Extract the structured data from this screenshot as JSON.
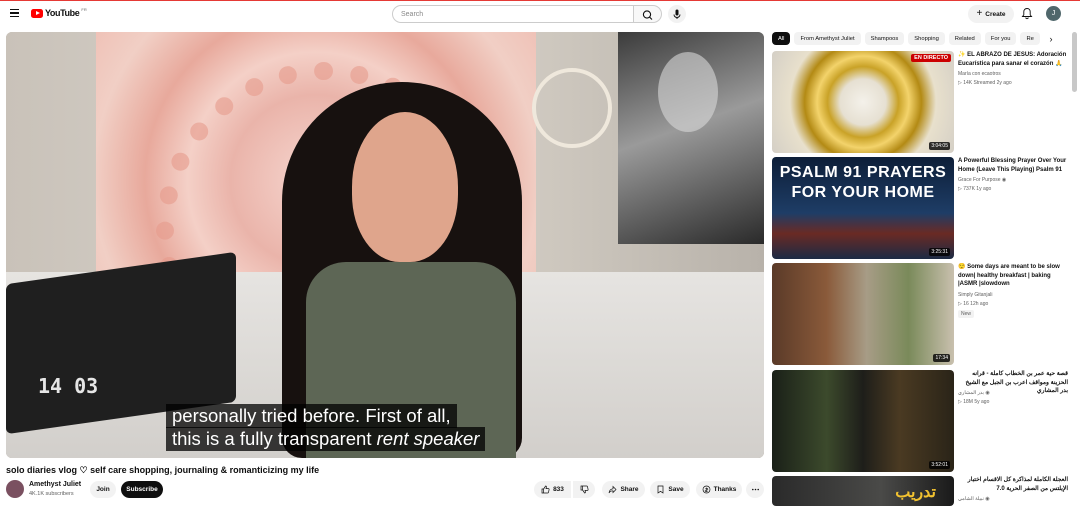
{
  "header": {
    "logo_text": "YouTube",
    "logo_country": "FR",
    "search_placeholder": "Search",
    "create_label": "Create",
    "avatar_letter": "J"
  },
  "player": {
    "caption_line1": "personally tried before. First of all,",
    "caption_line2_a": "this is a fully transparent ",
    "caption_line2_b": "rent speaker",
    "clock_text": "14 03"
  },
  "video": {
    "title": "solo diaries vlog ♡ self care shopping, journaling & romanticizing my life",
    "channel_name": "Amethyst Juliet",
    "subscribers": "4K.1K subscribers",
    "join_label": "Join",
    "subscribe_label": "Subscribe",
    "likes": "833",
    "share_label": "Share",
    "save_label": "Save",
    "thanks_label": "Thanks"
  },
  "chips": [
    "All",
    "From Amethyst Juliet",
    "Shampoos",
    "Shopping",
    "Related",
    "For you",
    "Re"
  ],
  "recommendations": [
    {
      "title": "✨ EL ABRAZO DE JESÚS: Adoración Eucarística para sanar el corazón 🙏",
      "channel": "María con ecaotros",
      "meta": "▷ 14K  Streamed 2y ago",
      "duration": "3:04:05",
      "live": "EN DIRECTO"
    },
    {
      "title": "A Powerful Blessing Prayer Over Your Home (Leave This Playing) Psalm 91",
      "channel": "Grace For Purpose ◉",
      "meta": "▷ 737K  1y ago",
      "duration": "3:25:31",
      "thumb_text": "PSALM 91 PRAYERS FOR YOUR HOME"
    },
    {
      "title": "😌 Some days are meant to be slow down| healthy breakfast | baking |ASMR |slowdown",
      "channel": "Simply Gitanjali",
      "meta": "▷ 16  12h ago",
      "badge": "New",
      "duration": "17:34"
    },
    {
      "title": "قصة حية عمر بن الخطاب كاملة - قرآنه الحزينة ومواقف اعرب بن الجبل مع الشيخ بدر المشاري",
      "channel": "بدر المشاري ◉",
      "meta": "▷ 18M  5y ago",
      "duration": "3:52:01"
    },
    {
      "title": "العجلة الكاملة لمذاكرة كل الاقسام اختبار الإيلتس من الصفر الحرية 7.0",
      "channel": "نبيلة الشامي ◉",
      "meta": "",
      "duration": "",
      "thumb_text": "تدريب"
    }
  ]
}
